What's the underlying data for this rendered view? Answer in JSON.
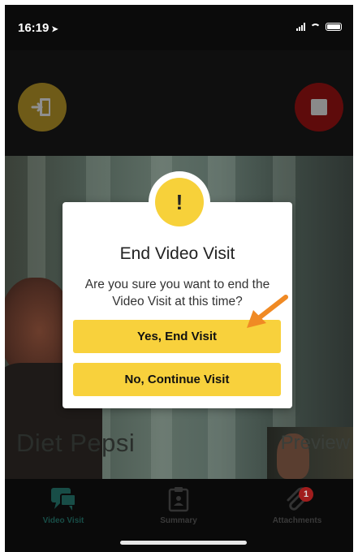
{
  "status_bar": {
    "time": "16:19",
    "location_glyph": "➤"
  },
  "call_controls": {
    "exit_icon": "exit-door-icon",
    "stop_icon": "stop-icon"
  },
  "video": {
    "caller_name": "Diet Pepsi",
    "preview_label": "Preview"
  },
  "dialog": {
    "alert_symbol": "!",
    "title": "End Video Visit",
    "message": "Are you sure you want to end the Video Visit at this time?",
    "confirm_label": "Yes, End Visit",
    "cancel_label": "No, Continue Visit"
  },
  "tabs": [
    {
      "label": "Video Visit",
      "icon": "video-chat-icon",
      "active": true
    },
    {
      "label": "Summary",
      "icon": "clipboard-icon",
      "active": false
    },
    {
      "label": "Attachments",
      "icon": "paperclip-icon",
      "badge": "1",
      "active": false
    }
  ],
  "colors": {
    "accent_yellow": "#f8d13c",
    "active_tab": "#184d47",
    "badge_red": "#a11d1d",
    "arrow_orange": "#f08a24"
  }
}
